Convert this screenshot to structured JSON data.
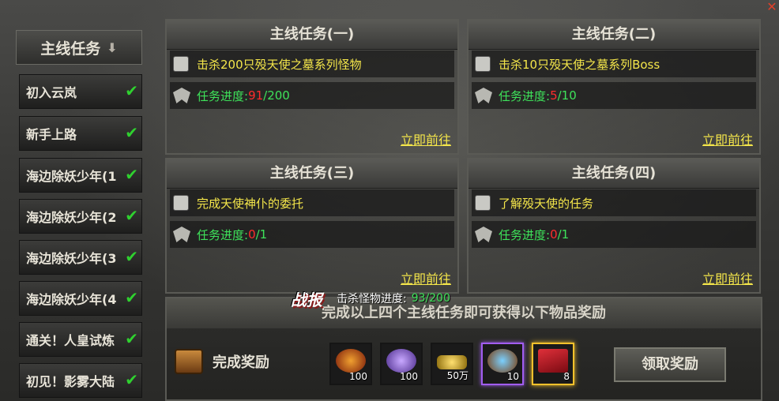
{
  "sidebar": {
    "header": "主线任务",
    "items": [
      {
        "label": "初入云岚"
      },
      {
        "label": "新手上路"
      },
      {
        "label": "海边除妖少年(1"
      },
      {
        "label": "海边除妖少年(2"
      },
      {
        "label": "海边除妖少年(3"
      },
      {
        "label": "海边除妖少年(4"
      },
      {
        "label": "通关！人皇试炼"
      },
      {
        "label": "初见！影雾大陆"
      }
    ]
  },
  "quests": [
    {
      "title": "主线任务(一)",
      "objective": "击杀200只殁天使之墓系列怪物",
      "progress_label": "任务进度: ",
      "current": "91",
      "total": "/200",
      "go": "立即前往"
    },
    {
      "title": "主线任务(二)",
      "objective": "击杀10只殁天使之墓系列Boss",
      "progress_label": "任务进度: ",
      "current": "5",
      "total": "/10",
      "go": "立即前往"
    },
    {
      "title": "主线任务(三)",
      "objective": "完成天使神仆的委托",
      "progress_label": "任务进度: ",
      "current": "0",
      "total": "/1",
      "go": "立即前往"
    },
    {
      "title": "主线任务(四)",
      "objective": "了解殁天使的任务",
      "progress_label": "任务进度: ",
      "current": "0",
      "total": "/1",
      "go": "立即前往"
    }
  ],
  "reward": {
    "banner": "完成以上四个主线任务即可获得以下物品奖励",
    "label": "完成奖励",
    "items": [
      {
        "count": "100",
        "icon": "fire-orb-icon",
        "color": "#c8401a"
      },
      {
        "count": "100",
        "icon": "purple-crystal-icon",
        "color": "#8a5ad8"
      },
      {
        "count": "50万",
        "icon": "gold-ingot-icon",
        "color": "#e0b21c"
      },
      {
        "count": "10",
        "icon": "magic-scroll-icon",
        "color": "#3aa0e0"
      },
      {
        "count": "8",
        "icon": "red-book-icon",
        "color": "#c81e28"
      }
    ],
    "claim": "领取奖励"
  },
  "tooltip": {
    "logo": "战报",
    "text": "击杀怪物进度: ",
    "value": "93/200"
  }
}
